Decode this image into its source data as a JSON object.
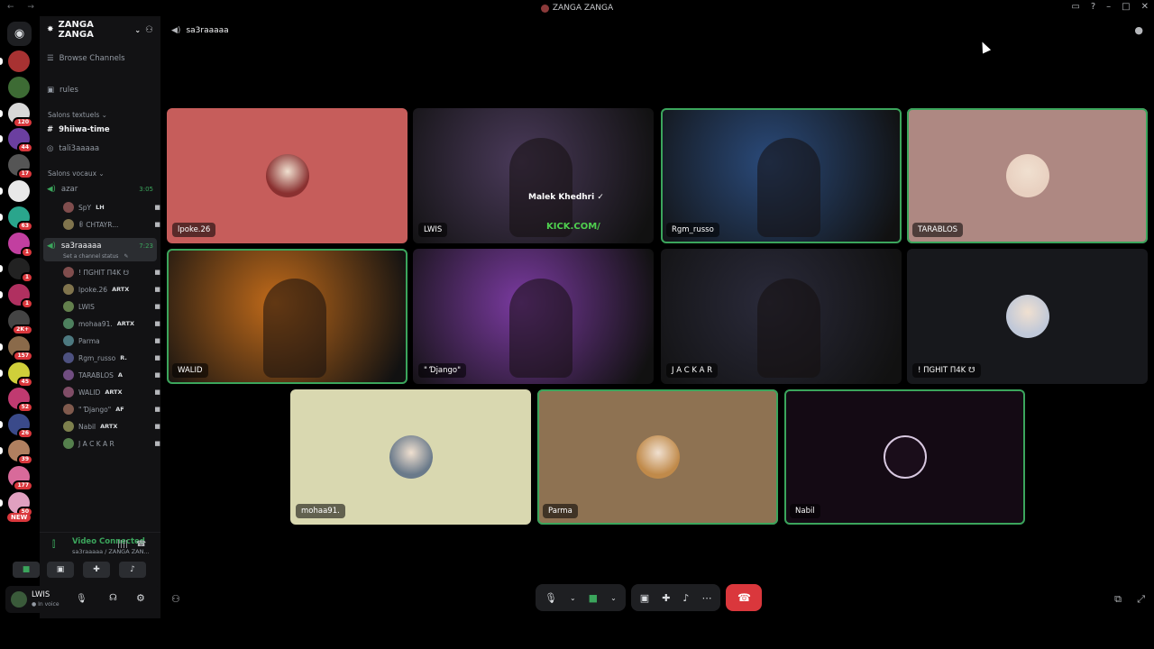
{
  "window": {
    "title": "ZANGA ZANGA",
    "nav": "← →"
  },
  "guilds": [
    {
      "color": "#a83232",
      "badge": ""
    },
    {
      "color": "#3d6b34",
      "badge": ""
    },
    {
      "color": "#d8d8d8",
      "badge": "120"
    },
    {
      "color": "#6b3fa0",
      "badge": "44"
    },
    {
      "color": "#555555",
      "badge": "17"
    },
    {
      "color": "#e8e8e8",
      "badge": ""
    },
    {
      "color": "#2aa58c",
      "badge": "63"
    },
    {
      "color": "#c23fa0",
      "badge": "1"
    },
    {
      "color": "#222222",
      "badge": "1"
    },
    {
      "color": "#b03060",
      "badge": "1"
    },
    {
      "color": "#444444",
      "badge": "2K+"
    },
    {
      "color": "#8a6a4a",
      "badge": "157"
    },
    {
      "color": "#cfcf3a",
      "badge": "45"
    },
    {
      "color": "#c03a70",
      "badge": "52"
    },
    {
      "color": "#3a4a8a",
      "badge": "26"
    },
    {
      "color": "#b08060",
      "badge": "39"
    },
    {
      "color": "#d86a9a",
      "badge": "177"
    },
    {
      "color": "#e0a0c0",
      "badge": "50"
    }
  ],
  "new_badge": "NEW",
  "server": {
    "name": "ZANGA ZANGA"
  },
  "channels": {
    "browse": "Browse Channels",
    "rules": "rules",
    "text_category": "Salons textuels",
    "text": [
      "9hiiwa-time",
      "tali3aaaaa"
    ],
    "voice_category": "Salons vocaux",
    "voice1": {
      "name": "azar",
      "time": "3:05"
    },
    "voice1_users": [
      {
        "name": "SpY",
        "tag": "LH"
      },
      {
        "name": "ꂦ CHTAYR...",
        "tag": ""
      }
    ],
    "voice2": {
      "name": "sa3raaaaa",
      "time": "7:23",
      "status": "Set a channel status"
    },
    "voice2_users": [
      {
        "name": "! ΠGΗIT Π4K ☋",
        "tag": ""
      },
      {
        "name": "lpoke.26",
        "tag": "ARTX"
      },
      {
        "name": "LWIS",
        "tag": ""
      },
      {
        "name": "mohaa91.",
        "tag": "ARTX"
      },
      {
        "name": "Parma",
        "tag": ""
      },
      {
        "name": "Rgm_russo",
        "tag": "R."
      },
      {
        "name": "TARABLOS",
        "tag": "A"
      },
      {
        "name": "WALID",
        "tag": "ARTX"
      },
      {
        "name": "\" Ɗjango\"",
        "tag": "AF"
      },
      {
        "name": "Nabil",
        "tag": "ARTX"
      },
      {
        "name": "J A C K A R",
        "tag": ""
      }
    ]
  },
  "voice_panel": {
    "status": "Video Connected",
    "sub": "sa3raaaaa / ZANGA ZAN..."
  },
  "user": {
    "name": "LWIS",
    "status": "In voice"
  },
  "stage": {
    "channel": "sa3raaaaa"
  },
  "tiles": [
    {
      "name": "lpoke.26",
      "bg": "#c65d5b",
      "type": "avatar",
      "avcolor": "#8a3030",
      "speaking": false
    },
    {
      "name": "LWIS",
      "bg": "#4a3a5a",
      "type": "video",
      "speaking": false,
      "overlay1": "Malek Khedhri ✓",
      "overlay2": "KICK.COM/"
    },
    {
      "name": "Rgm_russo",
      "bg": "#2a4a7a",
      "type": "video",
      "speaking": true
    },
    {
      "name": "TARABLOS",
      "bg": "#ae8882",
      "type": "avatar",
      "avcolor": "#e8d0c0",
      "speaking": true
    },
    {
      "name": "WALID",
      "bg": "#c06a1a",
      "type": "video",
      "speaking": true
    },
    {
      "name": "\" Ɗjango\"",
      "bg": "#7a3aa0",
      "type": "video",
      "speaking": false
    },
    {
      "name": "J A C K A R",
      "bg": "#2a2a3a",
      "type": "video",
      "speaking": false
    },
    {
      "name": "! ΠGΗIT Π4K ☋",
      "bg": "#17181c",
      "type": "avatar",
      "avcolor": "#c0c8d8",
      "speaking": false
    },
    {
      "name": "mohaa91.",
      "bg": "#d9d8b0",
      "type": "avatar",
      "avcolor": "#6a7a8a",
      "speaking": false
    },
    {
      "name": "Parma",
      "bg": "#8e7252",
      "type": "avatar",
      "avcolor": "#c08a4a",
      "speaking": true
    },
    {
      "name": "Nabil",
      "bg": "#140a14",
      "type": "avatar",
      "avcolor": "#2a1a2a",
      "speaking": true
    }
  ]
}
